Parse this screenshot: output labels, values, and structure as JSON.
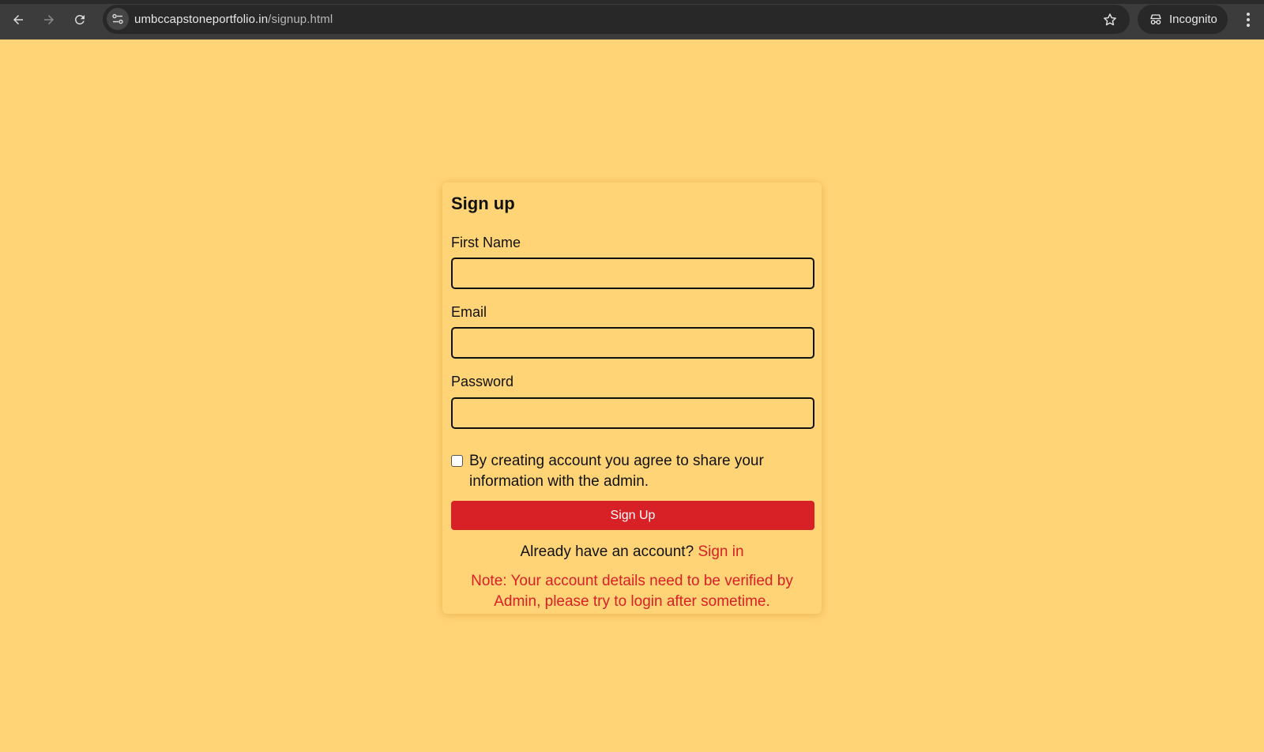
{
  "browser": {
    "url_host": "umbccapstoneportfolio.in",
    "url_path": "/signup.html",
    "incognito_label": "Incognito",
    "icons": [
      "back-arrow-icon",
      "forward-arrow-icon",
      "reload-icon",
      "site-info-icon",
      "star-icon",
      "incognito-icon",
      "more-vert-icon"
    ]
  },
  "form": {
    "title": "Sign up",
    "first_name_label": "First Name",
    "first_name_value": "",
    "email_label": "Email",
    "email_value": "",
    "password_label": "Password",
    "password_value": "",
    "agree_checked": false,
    "agree_text": "By creating account you agree to share your information with the admin.",
    "submit_label": "Sign Up",
    "already_text": "Already have an account?",
    "signin_link": "Sign in",
    "note": "Note: Your account details need to be verified by Admin, please try to login after sometime."
  },
  "colors": {
    "background": "#ffd477",
    "accent_red": "#d82027",
    "chrome_dark": "#3c3c3c"
  }
}
